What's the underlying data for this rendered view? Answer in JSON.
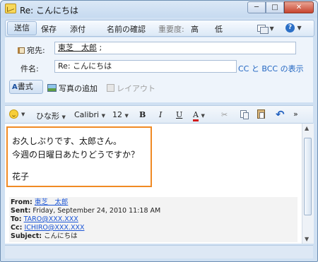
{
  "window": {
    "title": "Re: こんにちは",
    "minimize": "─",
    "maximize": "□",
    "close": "✕"
  },
  "toolbar": {
    "send": "送信",
    "save": "保存",
    "attach": "添付",
    "check_names": "名前の確認",
    "importance_label": "重要度:",
    "importance_high": "高",
    "importance_low": "低",
    "help_icon": "help-icon",
    "more_icon": "copy-doc-icon"
  },
  "header": {
    "to_label": "宛先:",
    "to_value": "東芝　太郎",
    "to_separator": ";",
    "subject_label": "件名:",
    "subject_value": "Re: こんにちは",
    "cc_bcc_link": "CC と BCC の表示",
    "format_button": "書式",
    "format_icon_text": "A",
    "attach_photo": "写真の追加",
    "layout": "レイアウト"
  },
  "format_bar": {
    "stationery": "ひな形",
    "font": "Calibri",
    "size": "12",
    "bold": "B",
    "italic": "I",
    "underline": "U",
    "text_color": "A",
    "scissors": "✂",
    "undo": "↶",
    "more": "»"
  },
  "message": {
    "line1": "お久しぶりです、太郎さん。",
    "line2": "今週の日曜日あたりどうですか？",
    "signature": "花子",
    "highlight_color": "#f08a24"
  },
  "quoted": {
    "from_label": "From:",
    "from_value": "東芝　太郎",
    "sent_label": "Sent:",
    "sent_value": "Friday, September 24, 2010 11:18 AM",
    "to_label": "To:",
    "to_value": "TARO@XXX.XXX",
    "cc_label": "Cc:",
    "cc_value": "ICHIRO@XXX.XXX",
    "subject_label": "Subject:",
    "subject_value": "こんにちは"
  }
}
